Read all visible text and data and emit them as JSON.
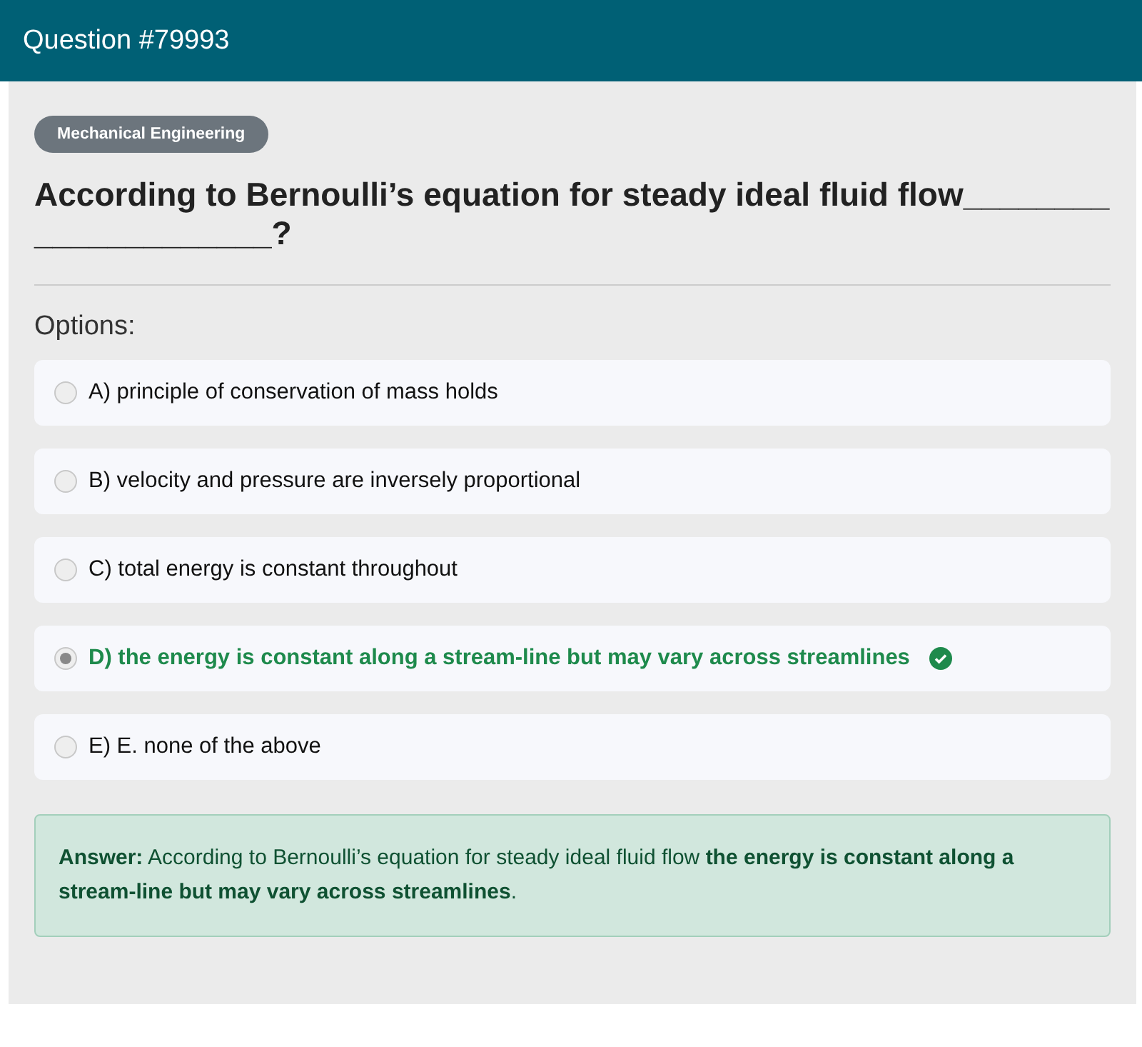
{
  "header": {
    "title": "Question #79993"
  },
  "category": "Mechanical Engineering",
  "question": "According to Bernoulli’s equation for steady ideal fluid flow_____________________?",
  "options_label": "Options:",
  "options": [
    {
      "text": "A) principle of conservation of mass holds",
      "selected": false,
      "correct": false
    },
    {
      "text": "B) velocity and pressure are inversely proportional",
      "selected": false,
      "correct": false
    },
    {
      "text": "C) total energy is constant throughout",
      "selected": false,
      "correct": false
    },
    {
      "text": "D) the energy is constant along a stream-line but may vary across streamlines",
      "selected": true,
      "correct": true
    },
    {
      "text": "E) E. none of the above",
      "selected": false,
      "correct": false
    }
  ],
  "answer": "**Answer:** According to Bernoulli’s equation for steady ideal fluid flow **the energy is constant along a stream-line but may vary across streamlines**."
}
